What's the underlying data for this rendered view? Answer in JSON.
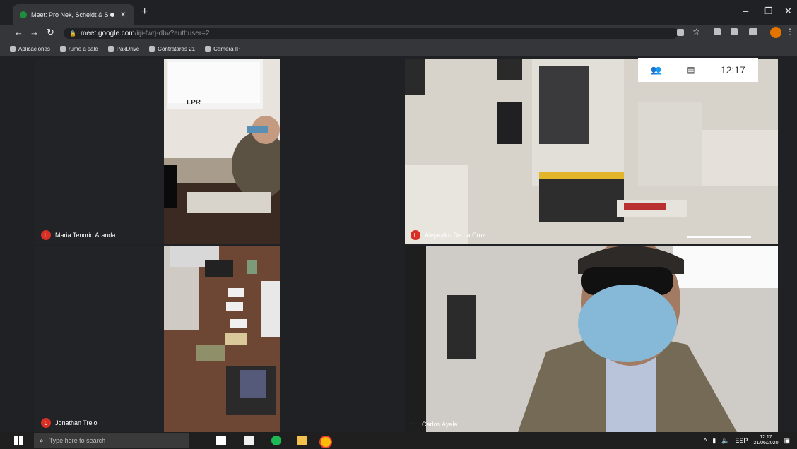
{
  "browser": {
    "tab_title": "Meet: Pro Nek, Scheidt & S...",
    "url_host": "meet.google.com",
    "url_path": "/iiji-fwrj-dbv?authuser=2",
    "bookmarks": [
      "Aplicaciones",
      "rumo a sale",
      "PaxDrive",
      "Contrataras 21",
      "Camera IP"
    ]
  },
  "meet": {
    "clock": "12:17",
    "participants": [
      {
        "name": "Maria Tenorio Aranda",
        "initial": "L"
      },
      {
        "name": "Alejandro De La Cruz",
        "initial": "L"
      },
      {
        "name": "Jonathan Trejo",
        "initial": "L"
      },
      {
        "name": "Carlos Ayala"
      }
    ],
    "banner_text": "LPR"
  },
  "taskbar": {
    "search_placeholder": "Type here to search",
    "tray_lang": "ESP",
    "tray_time": "12:17",
    "tray_date": "21/06/2020"
  },
  "colors": {
    "avatar": "#d93025",
    "chrome_dark": "#202124",
    "profile": "#e37400"
  }
}
